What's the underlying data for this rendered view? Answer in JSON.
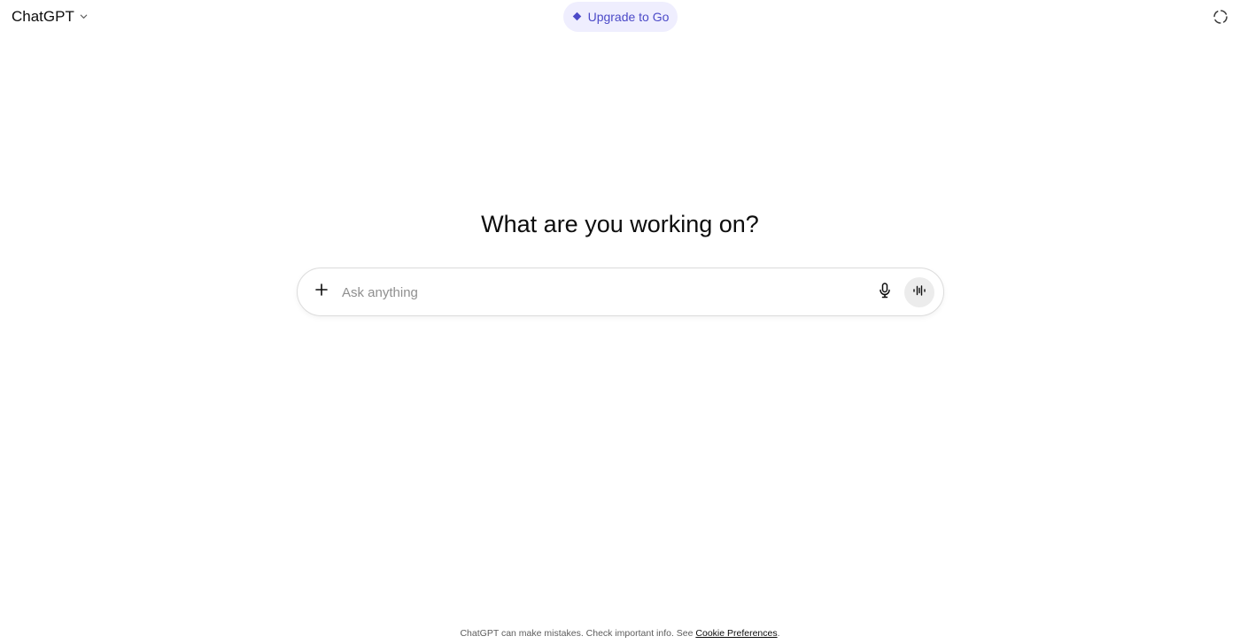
{
  "header": {
    "model_label": "ChatGPT",
    "upgrade_label": "Upgrade to Go",
    "accent_color": "#4c4ac8",
    "pill_background": "#efeefe",
    "icons": {
      "model_dropdown": "chevron-down-icon",
      "upgrade": "diamond-icon",
      "temporary_chat": "dashed-circle-icon"
    }
  },
  "main": {
    "headline": "What are you working on?"
  },
  "composer": {
    "placeholder": "Ask anything",
    "value": "",
    "icons": {
      "add": "plus-icon",
      "dictate": "microphone-icon",
      "voice_mode": "voice-waveform-icon"
    }
  },
  "footer": {
    "disclaimer_prefix": "ChatGPT can make mistakes. Check important info. See ",
    "link_label": "Cookie Preferences",
    "disclaimer_suffix": "."
  }
}
